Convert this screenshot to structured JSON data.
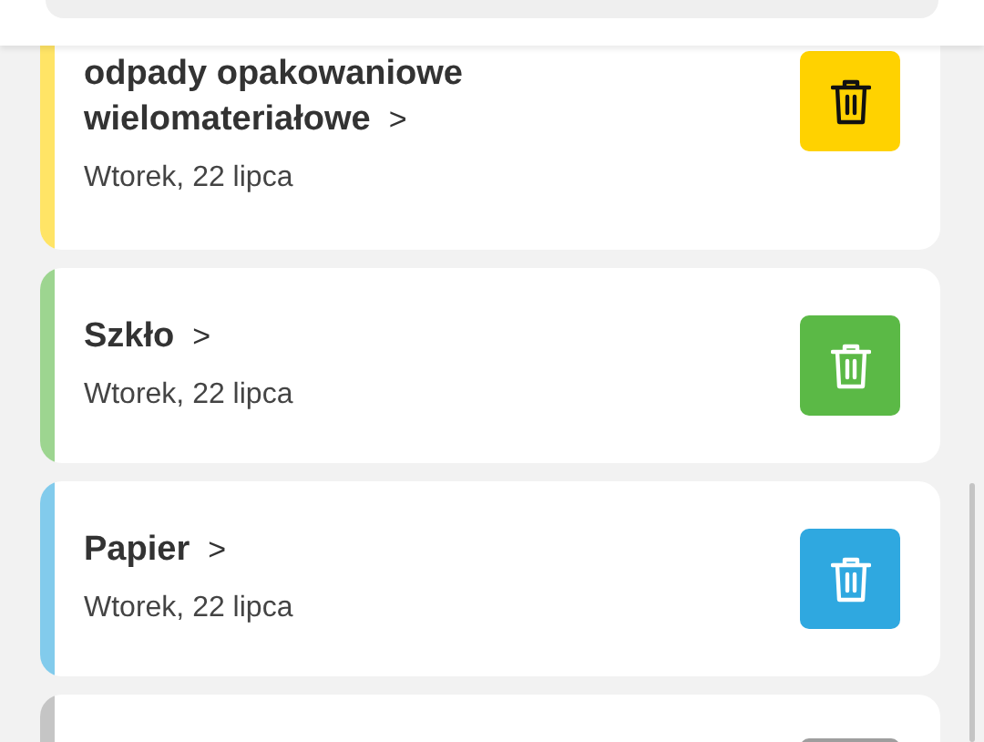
{
  "schedule": [
    {
      "title": "odpady opakowaniowe\nwielomateriałowe",
      "chevron": ">",
      "date": "Wtorek, 22 lipca",
      "color": "#ffd200"
    },
    {
      "title": "Szkło",
      "chevron": ">",
      "date": "Wtorek, 22 lipca",
      "color": "#5bb946"
    },
    {
      "title": "Papier",
      "chevron": ">",
      "date": "Wtorek, 22 lipca",
      "color": "#2fa8e0"
    },
    {
      "color": "#9e9e9e"
    }
  ]
}
